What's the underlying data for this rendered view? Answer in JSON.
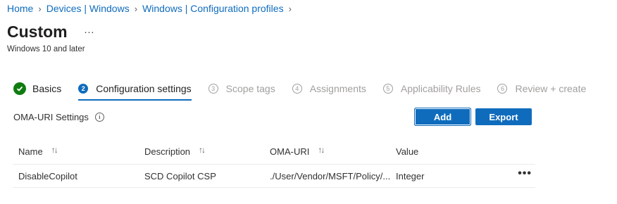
{
  "breadcrumb": [
    "Home",
    "Devices | Windows",
    "Windows | Configuration profiles"
  ],
  "page": {
    "title": "Custom",
    "more": "...",
    "subtitle": "Windows 10 and later"
  },
  "steps": [
    {
      "num": "",
      "label": "Basics",
      "state": "done"
    },
    {
      "num": "2",
      "label": "Configuration settings",
      "state": "current"
    },
    {
      "num": "3",
      "label": "Scope tags",
      "state": "disabled"
    },
    {
      "num": "4",
      "label": "Assignments",
      "state": "disabled"
    },
    {
      "num": "5",
      "label": "Applicability Rules",
      "state": "disabled"
    },
    {
      "num": "6",
      "label": "Review + create",
      "state": "disabled"
    }
  ],
  "oma_settings": {
    "label": "OMA-URI Settings",
    "info_icon": "i",
    "add_label": "Add",
    "export_label": "Export"
  },
  "table": {
    "columns": [
      "Name",
      "Description",
      "OMA-URI",
      "Value"
    ],
    "sort_glyph": "↑↓",
    "rows": [
      {
        "name": "DisableCopilot",
        "description": "SCD Copilot CSP",
        "oma_uri": "./User/Vendor/MSFT/Policy/...",
        "value": "Integer",
        "more": "•••"
      }
    ]
  },
  "colors": {
    "link": "#0f6cbd",
    "primary": "#0f6cbd",
    "success": "#107c10",
    "disabled": "#a19f9d"
  }
}
